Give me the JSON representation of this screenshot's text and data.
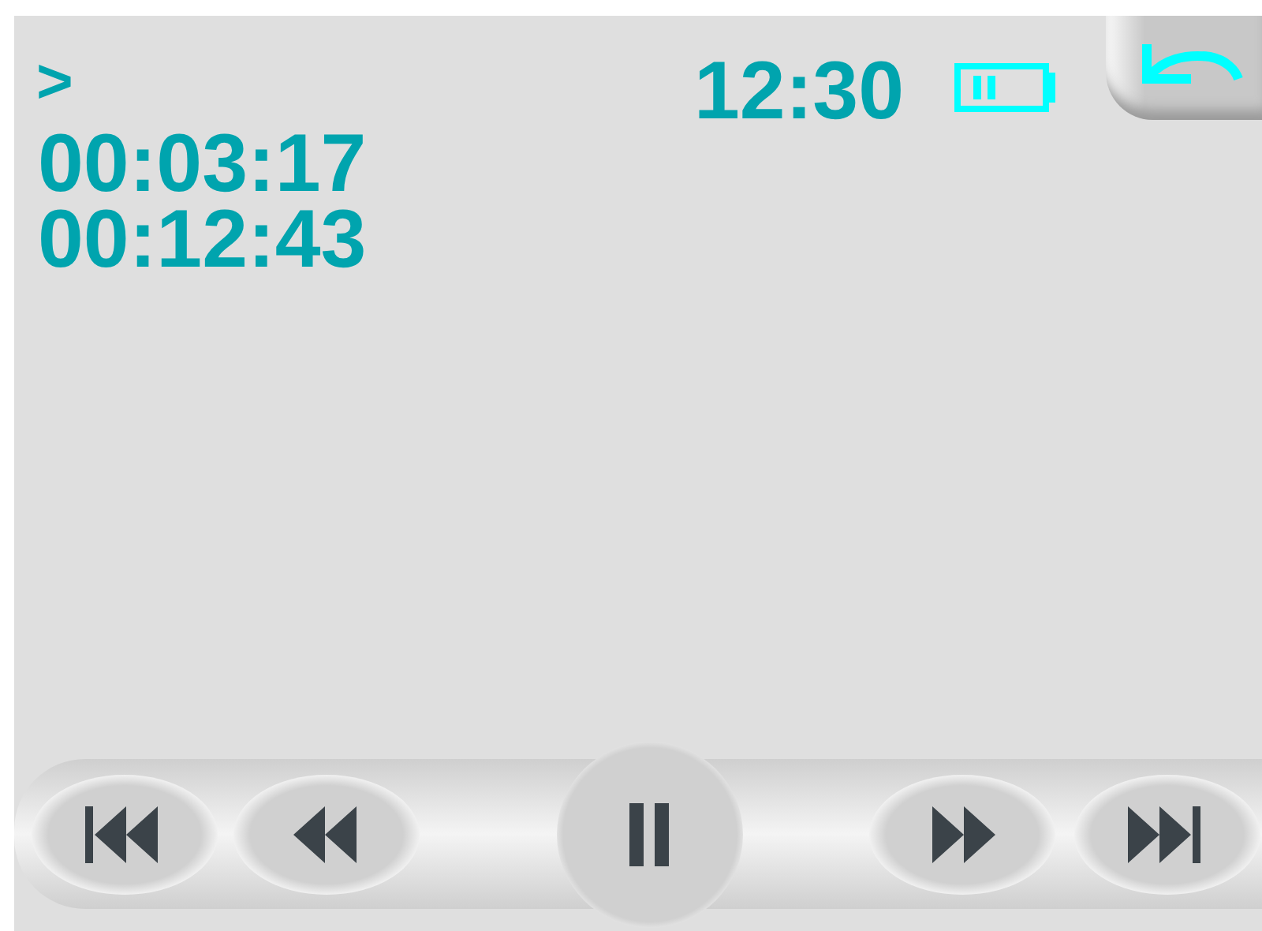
{
  "status": {
    "indicator": ">",
    "clock": "12:30"
  },
  "times": {
    "elapsed": "00:03:17",
    "total": "00:12:43"
  },
  "controls": [
    {
      "kind": "previous"
    },
    {
      "kind": "rewind"
    },
    {
      "kind": "pause"
    },
    {
      "kind": "forward"
    },
    {
      "kind": "next"
    }
  ]
}
